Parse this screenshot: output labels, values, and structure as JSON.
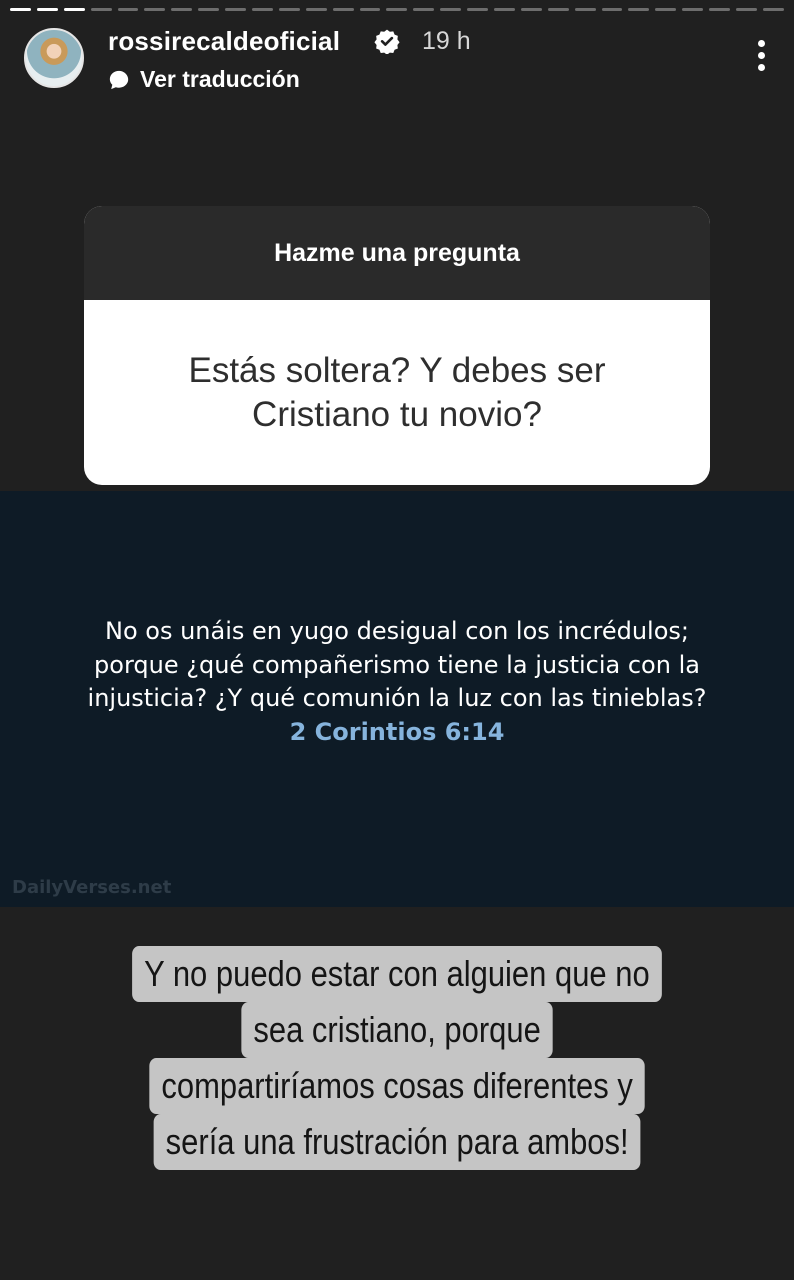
{
  "story": {
    "username": "rossirecaldeoficial",
    "verified": true,
    "time_ago": "19 h",
    "translate_label": "Ver traducción"
  },
  "question_sticker": {
    "header": "Hazme una pregunta",
    "question": "Estás soltera? Y debes ser Cristiano tu novio?"
  },
  "verse_card": {
    "text": "No os unáis en yugo desigual con los incrédulos; porque ¿qué compañerismo tiene la justicia con la injusticia? ¿Y qué comunión la luz con las tinieblas?",
    "reference": "2 Corintios 6:14",
    "watermark": "DailyVerses.net"
  },
  "reply_text": {
    "lines": [
      "Y no puedo estar con alguien que no",
      "sea cristiano, porque",
      "compartiríamos cosas diferentes y",
      "sería una frustración para ambos!"
    ]
  },
  "colors": {
    "background": "#202020",
    "verse_background": "#0e1b26",
    "verse_reference": "#86b4dd",
    "reply_highlight": "#c5c5c5"
  },
  "icons": {
    "verified": "verified-badge-icon",
    "translate": "speech-bubble-icon",
    "menu": "more-vertical-icon"
  }
}
